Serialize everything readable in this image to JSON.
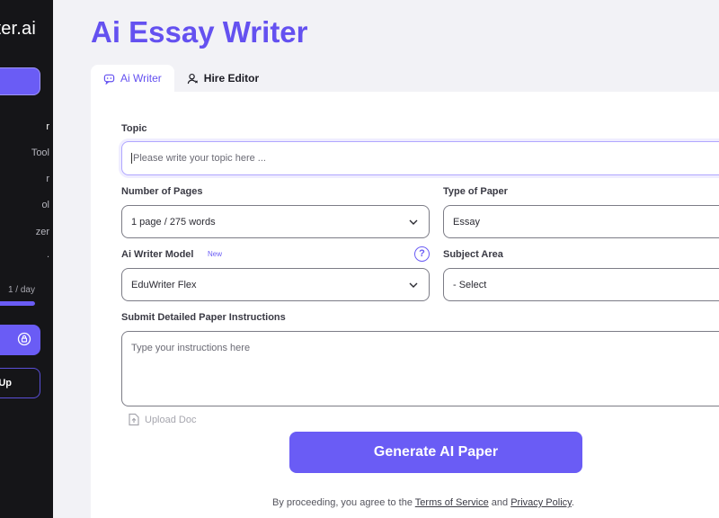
{
  "sidebar": {
    "logo": "ter.ai",
    "nav": [
      {
        "label": "r",
        "active": true
      },
      {
        "label": "Tool",
        "active": false
      },
      {
        "label": "r",
        "active": false
      },
      {
        "label": "ol",
        "active": false
      },
      {
        "label": "zer",
        "active": false
      },
      {
        "label": ".",
        "active": false
      }
    ],
    "usage_label": "1 / day",
    "usage_fraction": 1.0,
    "icon_button_icon": "lock-badge-icon",
    "outline_button_label": "Up"
  },
  "main": {
    "title": "Ai Essay Writer",
    "tabs": [
      {
        "label": "Ai Writer",
        "icon": "chat-bot-icon",
        "active": true
      },
      {
        "label": "Hire Editor",
        "icon": "user-icon",
        "active": false
      }
    ]
  },
  "form": {
    "topic": {
      "label": "Topic",
      "placeholder": "Please write your topic here ..."
    },
    "pages": {
      "label": "Number of Pages",
      "value": "1 page / 275 words"
    },
    "paper_type": {
      "label": "Type of Paper",
      "value": "Essay"
    },
    "model": {
      "label": "Ai Writer Model",
      "badge": "New",
      "value": "EduWriter Flex"
    },
    "subject": {
      "label": "Subject Area",
      "value": "- Select"
    },
    "instructions": {
      "label": "Submit Detailed Paper Instructions",
      "placeholder": "Type your instructions here"
    },
    "upload_label": "Upload Doc",
    "generate_label": "Generate AI Paper",
    "legal": {
      "prefix": "By proceeding, you agree to the ",
      "terms": "Terms of Service",
      "and": " and ",
      "privacy": "Privacy Policy",
      "suffix": "."
    }
  },
  "colors": {
    "accent": "#6a5cf5",
    "title": "#6451f0",
    "sidebar_bg": "#151518",
    "page_bg": "#f2f2f6"
  }
}
